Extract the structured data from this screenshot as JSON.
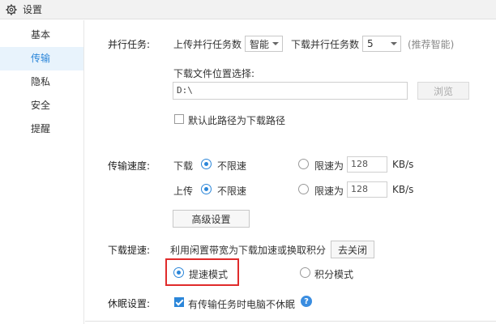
{
  "window": {
    "title": "设置",
    "icon": "gear-icon"
  },
  "sidebar": {
    "items": [
      {
        "label": "基本",
        "active": false
      },
      {
        "label": "传输",
        "active": true
      },
      {
        "label": "隐私",
        "active": false
      },
      {
        "label": "安全",
        "active": false
      },
      {
        "label": "提醒",
        "active": false
      }
    ]
  },
  "parallel": {
    "section_label": "并行任务:",
    "upload_label": "上传并行任务数",
    "upload_value": "智能",
    "download_label": "下载并行任务数",
    "download_value": "5",
    "hint": "(推荐智能)"
  },
  "download_location": {
    "label": "下载文件位置选择:",
    "path": "D:\\",
    "browse_label": "浏览",
    "default_checkbox_label": "默认此路径为下载路径",
    "default_checked": false
  },
  "speed": {
    "section_label": "传输速度:",
    "download": {
      "label": "下载",
      "unlimited_label": "不限速",
      "limit_label": "限速为",
      "limit_value": "128",
      "unit": "KB/s",
      "unlimited_selected": true
    },
    "upload": {
      "label": "上传",
      "unlimited_label": "不限速",
      "limit_label": "限速为",
      "limit_value": "128",
      "unit": "KB/s",
      "unlimited_selected": true
    },
    "advanced_button": "高级设置"
  },
  "boost": {
    "section_label": "下载提速:",
    "description": "利用闲置带宽为下载加速或换取积分",
    "close_button": "去关闭",
    "speed_mode_label": "提速模式",
    "points_mode_label": "积分模式",
    "speed_mode_selected": true
  },
  "sleep": {
    "section_label": "休眠设置:",
    "checkbox_label": "有传输任务时电脑不休眠",
    "checked": true,
    "help_icon": "question-icon"
  },
  "colors": {
    "accent": "#2b86d9",
    "highlight": "#e02b2b",
    "active_bg": "#e8f3fc"
  }
}
